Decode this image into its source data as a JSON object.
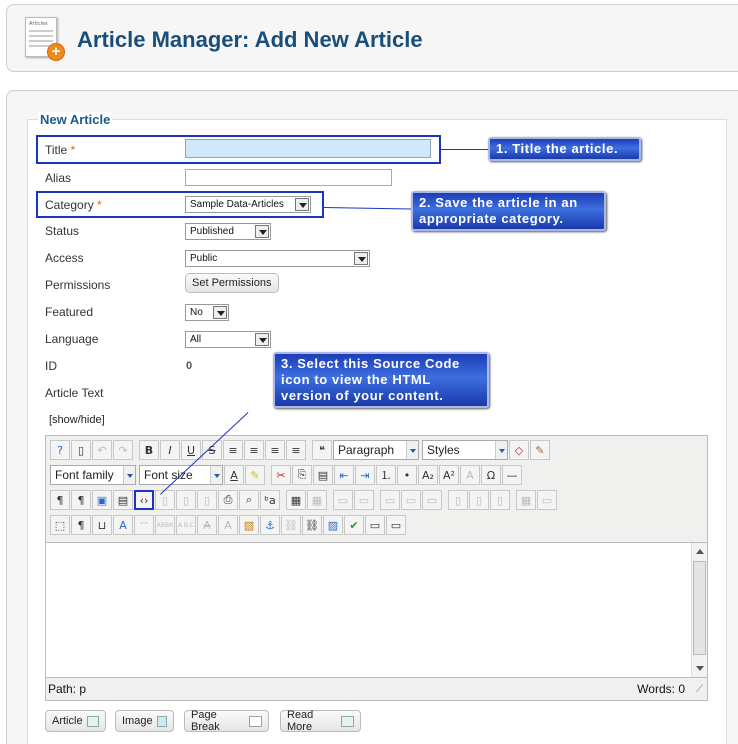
{
  "header": {
    "title": "Article Manager: Add New Article",
    "icon_text": "Articles"
  },
  "form": {
    "legend": "New Article",
    "title_label": "Title",
    "required_mark": "*",
    "alias_label": "Alias",
    "category_label": "Category",
    "category_value": "Sample Data-Articles",
    "status_label": "Status",
    "status_value": "Published",
    "access_label": "Access",
    "access_value": "Public",
    "permissions_label": "Permissions",
    "permissions_button": "Set Permissions",
    "featured_label": "Featured",
    "featured_value": "No",
    "language_label": "Language",
    "language_value": "All",
    "id_label": "ID",
    "id_value": "0",
    "article_text_label": "Article Text",
    "show_hide": "[show/hide]"
  },
  "callouts": {
    "one": "1. Title the article.",
    "two": "2. Save the article in an appropriate category.",
    "three": "3. Select this Source Code icon to view the HTML version of your content.",
    "color": "#1a35c0"
  },
  "editor": {
    "format_select": "Paragraph",
    "styles_select": "Styles",
    "font_family": "Font family",
    "font_size": "Font size",
    "path_label": "Path:",
    "path_value": "p",
    "words_label": "Words:",
    "words_value": "0"
  },
  "buttons": {
    "article": "Article",
    "image": "Image",
    "page_break": "Page Break",
    "read_more": "Read More"
  }
}
